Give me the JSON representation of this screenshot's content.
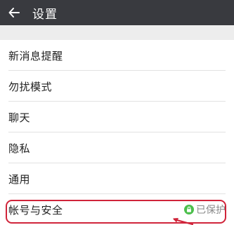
{
  "header": {
    "title": "设置",
    "back_icon": "back-arrow-icon"
  },
  "settings": {
    "items": [
      {
        "label": "新消息提醒"
      },
      {
        "label": "勿扰模式"
      },
      {
        "label": "聊天"
      },
      {
        "label": "隐私"
      },
      {
        "label": "通用"
      },
      {
        "label": "帐号与安全",
        "status": "已保护",
        "status_icon": "lock-icon"
      }
    ]
  },
  "colors": {
    "app_bar": "#393a3f",
    "status_icon_green": "#4cbf4c",
    "annotation_red": "#d0243a"
  }
}
